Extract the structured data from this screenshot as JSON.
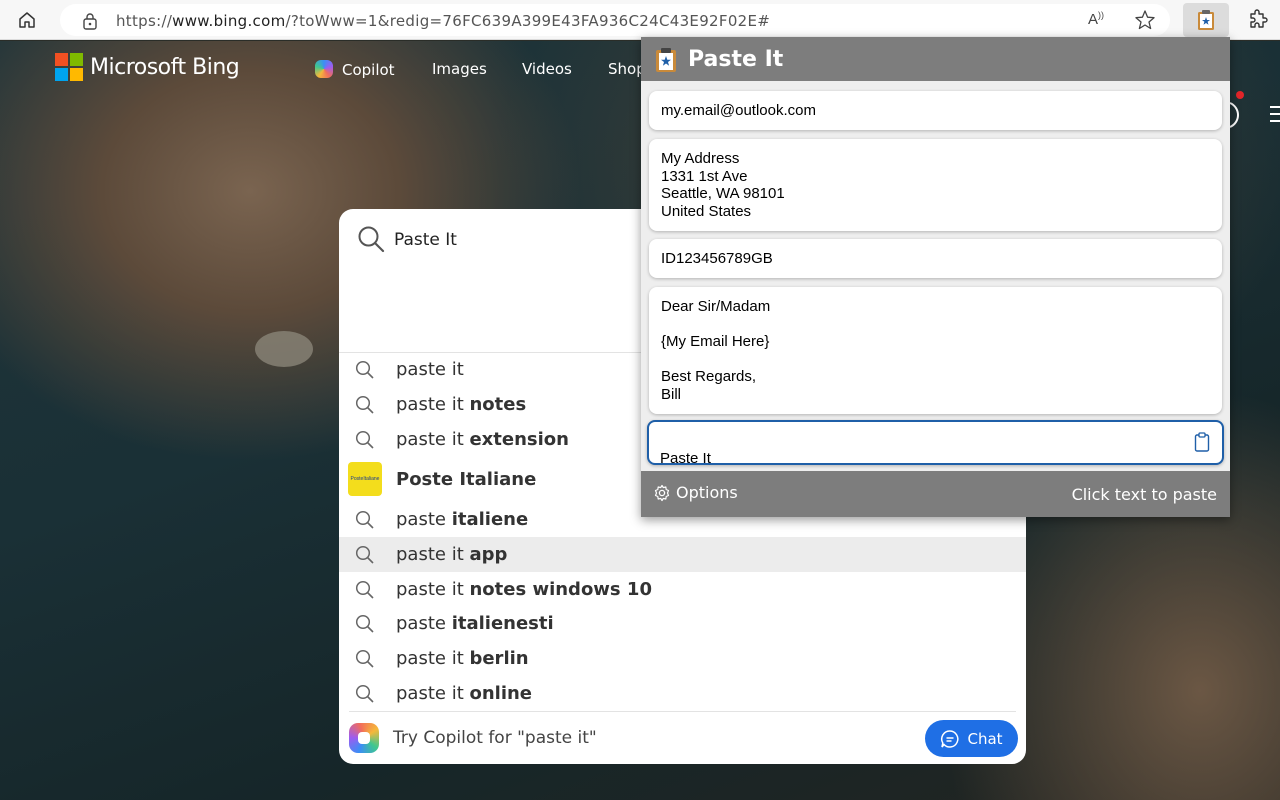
{
  "browser": {
    "url_prefix": "https://",
    "url_domain": "www.bing.com",
    "url_rest": "/?toWww=1&redig=76FC639A399E43FA936C24C43E92F02E#",
    "read_aloud_icon": "read-aloud-icon",
    "favorite_icon": "star-icon"
  },
  "bing": {
    "logo_text": "Microsoft Bing",
    "nav": [
      "Copilot",
      "Images",
      "Videos",
      "Shop"
    ],
    "logo_colors": [
      "#f25022",
      "#7fba00",
      "#00a4ef",
      "#ffb900"
    ]
  },
  "search": {
    "query": "Paste It",
    "suggestions": [
      {
        "plain": "paste it",
        "bold": ""
      },
      {
        "plain": "paste it ",
        "bold": "notes"
      },
      {
        "plain": "paste it ",
        "bold": "extension"
      },
      {
        "plain": "",
        "bold": "Poste Italiane"
      },
      {
        "plain": "paste ",
        "bold": "italiene"
      },
      {
        "plain": "paste it ",
        "bold": "app"
      },
      {
        "plain": "paste it ",
        "bold": "notes windows 10"
      },
      {
        "plain": "paste ",
        "bold": "italienesti"
      },
      {
        "plain": "paste it ",
        "bold": "berlin"
      },
      {
        "plain": "paste it ",
        "bold": "online"
      }
    ],
    "poste_logo_text": "PosteItaliane",
    "copilot_prompt": "Try Copilot for \"paste it\"",
    "chat_label": "Chat"
  },
  "pasteit": {
    "title": "Paste It",
    "snippets": [
      "my.email@outlook.com",
      "My Address\n1331 1st Ave\nSeattle, WA 98101\nUnited States",
      "ID123456789GB",
      "Dear Sir/Madam\n\n{My Email Here}\n\nBest Regards,\nBill"
    ],
    "input_value": "Paste It",
    "options_label": "Options",
    "hint": "Click text to paste",
    "accent": "#1f5fa8",
    "header_color": "#7d7d7d"
  }
}
